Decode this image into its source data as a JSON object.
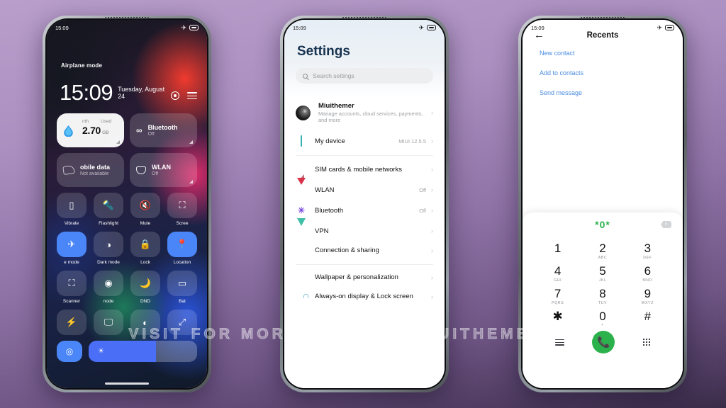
{
  "watermark": "VISIT FOR MORE THEMES - MIUITHEMER.COM",
  "status_bar": {
    "time": "15:09",
    "airplane_icon": "airplane-icon",
    "battery_icon": "battery-icon"
  },
  "control_center": {
    "airplane_label": "Airplane mode",
    "time": "15:09",
    "date": "Tuesday, August 24",
    "gear_icon": "gear-icon",
    "menu_icon": "hamburger-menu-icon",
    "data_tile": {
      "period_label": "nth",
      "used_label": "Used",
      "value": "2.70",
      "unit": "GB",
      "icon": "data-drop-icon"
    },
    "bluetooth_tile": {
      "title": "Bluetooth",
      "status": "Off",
      "icon": "bluetooth-icon"
    },
    "mobile_tile": {
      "title": "obile data",
      "status": "Not available",
      "icon": "mobile-data-icon"
    },
    "wlan_tile": {
      "title": "WLAN",
      "status": "Off",
      "icon": "wlan-icon"
    },
    "tiles": [
      {
        "label": "Vibrate",
        "icon": "vibrate-icon",
        "glyph": "•▮•",
        "on": false
      },
      {
        "label": "Flashlight",
        "icon": "flashlight-icon",
        "glyph": "ὒ6",
        "on": false
      },
      {
        "label": "Mute",
        "icon": "mute-icon",
        "glyph": "ὐ7",
        "on": false
      },
      {
        "label": "Scree",
        "icon": "screenshot-icon",
        "glyph": "✂",
        "on": false
      },
      {
        "label": "e mode",
        "icon": "airplane-mode-icon",
        "glyph": "✈",
        "on": true
      },
      {
        "label": "Dark mode",
        "icon": "dark-mode-icon",
        "glyph": "◑",
        "on": false
      },
      {
        "label": "Lock",
        "icon": "lock-icon",
        "glyph": "ὑ2",
        "on": false
      },
      {
        "label": "Location",
        "icon": "location-icon",
        "glyph": "ὌD",
        "on": true
      },
      {
        "label": "Scanner",
        "icon": "scanner-icon",
        "glyph": "⬚",
        "on": false
      },
      {
        "label": "node",
        "icon": "reading-mode-icon",
        "glyph": "ὄ1",
        "on": false
      },
      {
        "label": "DND",
        "icon": "dnd-icon",
        "glyph": "ἱ9",
        "on": false
      },
      {
        "label": "Bat",
        "icon": "battery-saver-icon",
        "glyph": "ὐB",
        "on": false
      }
    ],
    "tiles_row4": [
      {
        "icon": "power-saver-icon",
        "glyph": "⚡"
      },
      {
        "icon": "cast-screen-icon",
        "glyph": "὚5"
      },
      {
        "icon": "contrast-icon",
        "glyph": "◐"
      },
      {
        "icon": "rotate-screen-icon",
        "glyph": "↗"
      }
    ],
    "bottom_row": {
      "sync_icon": "sync-icon",
      "brightness_icon": "brightness-sun-icon",
      "brightness_percent": 62
    }
  },
  "settings": {
    "title": "Settings",
    "search_placeholder": "Search settings",
    "search_icon": "search-icon",
    "account": {
      "name": "Miuithemer",
      "description": "Manage accounts, cloud services, payments, and more",
      "avatar": "avatar"
    },
    "items": [
      {
        "name": "My device",
        "value": "MIUI 12.5.5",
        "icon": "phone-device-icon",
        "divider_after": true
      },
      {
        "name": "SIM cards & mobile networks",
        "value": "",
        "icon": "sim-card-icon",
        "divider_after": false
      },
      {
        "name": "WLAN",
        "value": "Off",
        "icon": "wlan-icon",
        "divider_after": false
      },
      {
        "name": "Bluetooth",
        "value": "Off",
        "icon": "bluetooth-icon",
        "divider_after": false
      },
      {
        "name": "VPN",
        "value": "",
        "icon": "vpn-icon",
        "divider_after": false
      },
      {
        "name": "Connection & sharing",
        "value": "",
        "icon": "connection-sharing-icon",
        "divider_after": true
      },
      {
        "name": "Wallpaper & personalization",
        "value": "",
        "icon": "wallpaper-icon",
        "divider_after": false
      },
      {
        "name": "Always-on display & Lock screen",
        "value": "",
        "icon": "lock-screen-icon",
        "divider_after": false
      }
    ],
    "chevron": "›"
  },
  "dialer": {
    "back_icon": "back-arrow-icon",
    "title": "Recents",
    "links": [
      "New contact",
      "Add to contacts",
      "Send message"
    ],
    "number": "*0*",
    "delete_icon": "backspace-icon",
    "keys": [
      {
        "digit": "1",
        "letters": " "
      },
      {
        "digit": "2",
        "letters": "ABC"
      },
      {
        "digit": "3",
        "letters": "DEF"
      },
      {
        "digit": "4",
        "letters": "GHI"
      },
      {
        "digit": "5",
        "letters": "JKL"
      },
      {
        "digit": "6",
        "letters": "MNO"
      },
      {
        "digit": "7",
        "letters": "PQRS"
      },
      {
        "digit": "8",
        "letters": "TUV"
      },
      {
        "digit": "9",
        "letters": "WXYZ"
      },
      {
        "digit": "✱",
        "letters": ""
      },
      {
        "digit": "0",
        "letters": "+"
      },
      {
        "digit": "#",
        "letters": ""
      }
    ],
    "menu_icon": "menu-icon",
    "call_icon": "call-icon",
    "keypad_icon": "keypad-icon"
  }
}
